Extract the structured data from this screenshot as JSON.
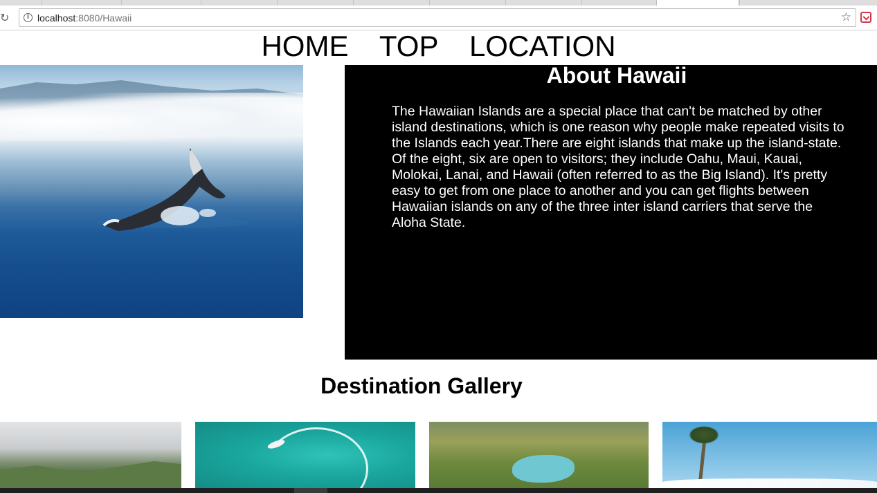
{
  "browser": {
    "url_host": "localhost",
    "url_port_path": ":8080/Hawaii"
  },
  "nav": {
    "items": [
      "HOME",
      "TOP",
      "LOCATION"
    ]
  },
  "about": {
    "title": "About Hawaii",
    "body": "The Hawaiian Islands are a special place that can't be matched by other island destinations, which is one reason why people make repeated visits to the Islands each year.There are eight islands that make up the island-state. Of the eight, six are open to visitors; they include Oahu, Maui, Kauai, Molokai, Lanai, and Hawaii (often referred to as the Big Island). It's pretty easy to get from one place to another and you can get flights between Hawaiian islands on any of the three inter island carriers that serve the Aloha State."
  },
  "gallery": {
    "title": "Destination Gallery"
  },
  "colors": {
    "about_bg": "#000000",
    "about_text": "#ffffff",
    "page_bg": "#ffffff"
  },
  "icons": [
    "reload-icon",
    "info-icon",
    "star-icon",
    "pocket-icon"
  ]
}
